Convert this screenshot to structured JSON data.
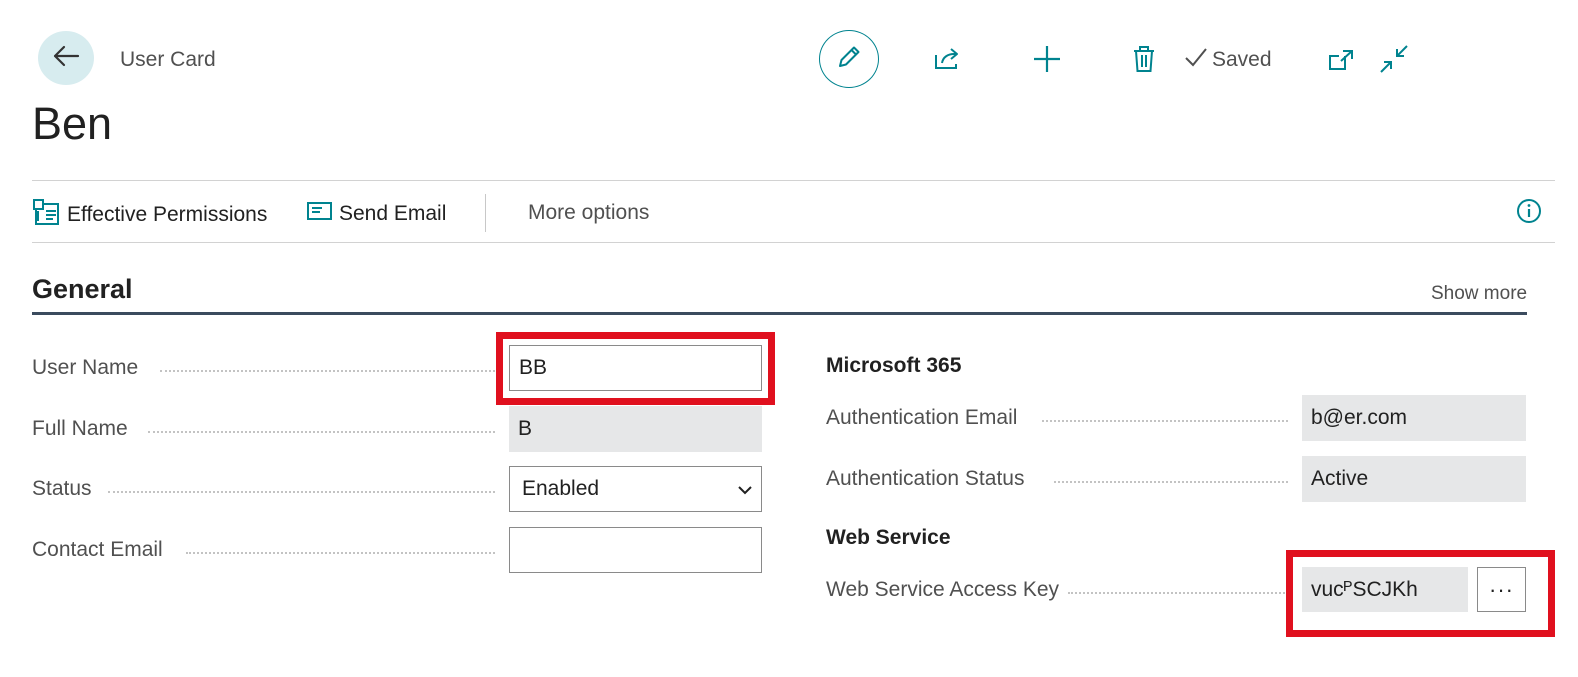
{
  "header": {
    "breadcrumb": "User Card",
    "title": "Ben",
    "status": "Saved"
  },
  "actions": {
    "effective_permissions": "Effective Permissions",
    "send_email": "Send Email",
    "more_options": "More options"
  },
  "section": {
    "title": "General",
    "show_more": "Show more"
  },
  "fields_left": {
    "user_name": {
      "label": "User Name",
      "value": "BB"
    },
    "full_name": {
      "label": "Full Name",
      "value": "B"
    },
    "status": {
      "label": "Status",
      "value": "Enabled"
    },
    "contact_email": {
      "label": "Contact Email",
      "value": ""
    }
  },
  "fields_right": {
    "microsoft365_heading": "Microsoft 365",
    "auth_email": {
      "label": "Authentication Email",
      "value": "b@er.com"
    },
    "auth_status": {
      "label": "Authentication Status",
      "value": "Active"
    },
    "web_service_heading": "Web Service",
    "ws_key": {
      "label": "Web Service Access Key",
      "value": "vucᴾSCJKh",
      "button": "···"
    }
  },
  "icons": {
    "back": "arrow-left-icon",
    "edit": "pencil-icon",
    "share": "share-icon",
    "new": "plus-icon",
    "delete": "trash-icon",
    "saved": "checkmark-icon",
    "open_new_window": "open-new-window-icon",
    "collapse": "collapse-icon",
    "permissions": "permissions-icon",
    "email": "email-icon",
    "info": "info-icon"
  },
  "colors": {
    "accent": "#00838f",
    "highlight": "#e0101e",
    "readonly_bg": "#e6e7e8"
  }
}
